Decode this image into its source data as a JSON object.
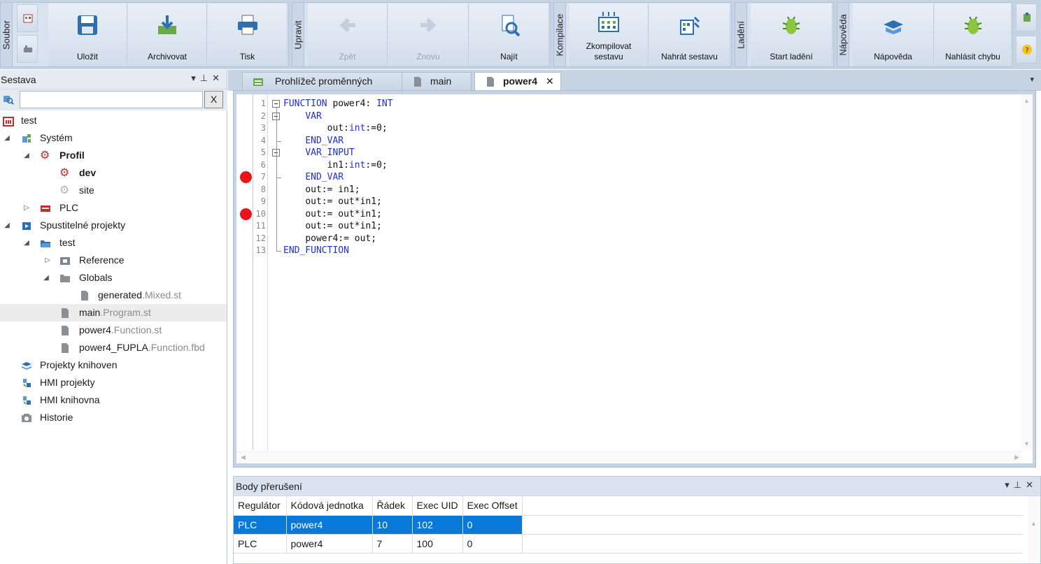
{
  "ribbon": {
    "groups": {
      "soubor": "Soubor",
      "upravit": "Upravit",
      "kompilace": "Kompilace",
      "ladeni": "Ladění",
      "napoveda": "Nápověda"
    },
    "buttons": {
      "save": "Uložit",
      "archive": "Archivovat",
      "print": "Tisk",
      "undo": "Zpět",
      "redo": "Znovu",
      "find": "Najít",
      "compile": "Zkompilovat sestavu",
      "upload": "Nahrát sestavu",
      "debug": "Start ladění",
      "help": "Nápověda",
      "report": "Nahlásit chybu"
    }
  },
  "left_panel": {
    "title": "Sestava",
    "search_value": "",
    "clear_label": "X",
    "tree": [
      {
        "label": "test"
      },
      {
        "label": "Systém"
      },
      {
        "label": "Profil"
      },
      {
        "label": "dev"
      },
      {
        "label": "site"
      },
      {
        "label": "PLC"
      },
      {
        "label": "Spustitelné projekty"
      },
      {
        "label": "test"
      },
      {
        "label": "Reference"
      },
      {
        "label": "Globals"
      },
      {
        "label": "generated",
        "ext": ".Mixed.st"
      },
      {
        "label": "main",
        "ext": ".Program.st"
      },
      {
        "label": "power4",
        "ext": ".Function.st"
      },
      {
        "label": "power4_FUPLA",
        "ext": ".Function.fbd"
      },
      {
        "label": "Projekty knihoven"
      },
      {
        "label": "HMI projekty"
      },
      {
        "label": "HMI knihovna"
      },
      {
        "label": "Historie"
      }
    ]
  },
  "tabs": [
    {
      "label": "Prohlížeč proměnných"
    },
    {
      "label": "main"
    },
    {
      "label": "power4",
      "close": "✕"
    }
  ],
  "editor": {
    "line_numbers": [
      "1",
      "2",
      "3",
      "4",
      "5",
      "6",
      "7",
      "8",
      "9",
      "10",
      "11",
      "12",
      "13"
    ],
    "breakpoint_lines": [
      7,
      10
    ],
    "lines": [
      {
        "kw": "FUNCTION",
        "rest": " power4: ",
        "kw2": "INT"
      },
      {
        "indent": "    ",
        "kw": "VAR"
      },
      {
        "indent": "        ",
        "rest": "out:",
        "kw2": "int",
        "rest2": ":=0;"
      },
      {
        "indent": "    ",
        "kw": "END_VAR"
      },
      {
        "indent": "    ",
        "kw": "VAR_INPUT"
      },
      {
        "indent": "        ",
        "rest": "in1:",
        "kw2": "int",
        "rest2": ":=0;"
      },
      {
        "indent": "    ",
        "kw": "END_VAR"
      },
      {
        "indent": "    ",
        "rest": "out:= in1;"
      },
      {
        "indent": "    ",
        "rest": "out:= out*in1;"
      },
      {
        "indent": "    ",
        "rest": "out:= out*in1;"
      },
      {
        "indent": "    ",
        "rest": "out:= out*in1;"
      },
      {
        "indent": "    ",
        "rest": "power4:= out;"
      },
      {
        "kw": "END_FUNCTION"
      }
    ]
  },
  "breakpoints_panel": {
    "title": "Body přerušení",
    "columns": [
      "Regulátor",
      "Kódová jednotka",
      "Řádek",
      "Exec UID",
      "Exec Offset"
    ],
    "rows": [
      [
        "PLC",
        "power4",
        "10",
        "102",
        "0"
      ],
      [
        "PLC",
        "power4",
        "7",
        "100",
        "0"
      ]
    ]
  },
  "colors": {
    "accent": "#0a78d7",
    "breakpoint": "#e8141c",
    "keyword": "#1f2fd6"
  }
}
